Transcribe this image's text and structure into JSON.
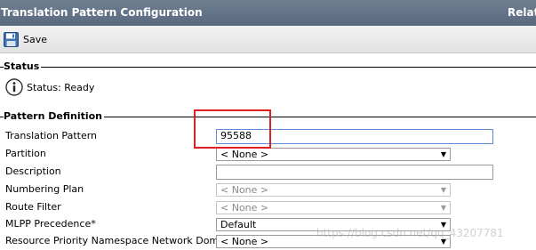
{
  "header": {
    "title": "Translation Pattern Configuration",
    "related_links_label": "Relate"
  },
  "toolbar": {
    "save_label": "Save",
    "save_icon": "floppy-disk-icon"
  },
  "status_section": {
    "legend": "Status",
    "status_icon": "info-icon",
    "status_text": "Status: Ready"
  },
  "pattern_section": {
    "legend": "Pattern Definition",
    "fields": {
      "translation_pattern": {
        "label": "Translation Pattern",
        "value": "95588"
      },
      "partition": {
        "label": "Partition",
        "value": "< None >"
      },
      "description": {
        "label": "Description",
        "value": ""
      },
      "numbering_plan": {
        "label": "Numbering Plan",
        "value": "< None >"
      },
      "route_filter": {
        "label": "Route Filter",
        "value": "< None >"
      },
      "mlpp_precedence": {
        "label": "MLPP Precedence*",
        "value": "Default"
      },
      "resource_priority_namespace": {
        "label": "Resource Priority Namespace Network Domain",
        "value": "< None >"
      }
    }
  },
  "watermark": "https://blog.csdn.net/qq_43207781",
  "colors": {
    "titlebar": "#5f6f83",
    "highlight": "#e02020",
    "focus_border": "#5b8ed6"
  }
}
